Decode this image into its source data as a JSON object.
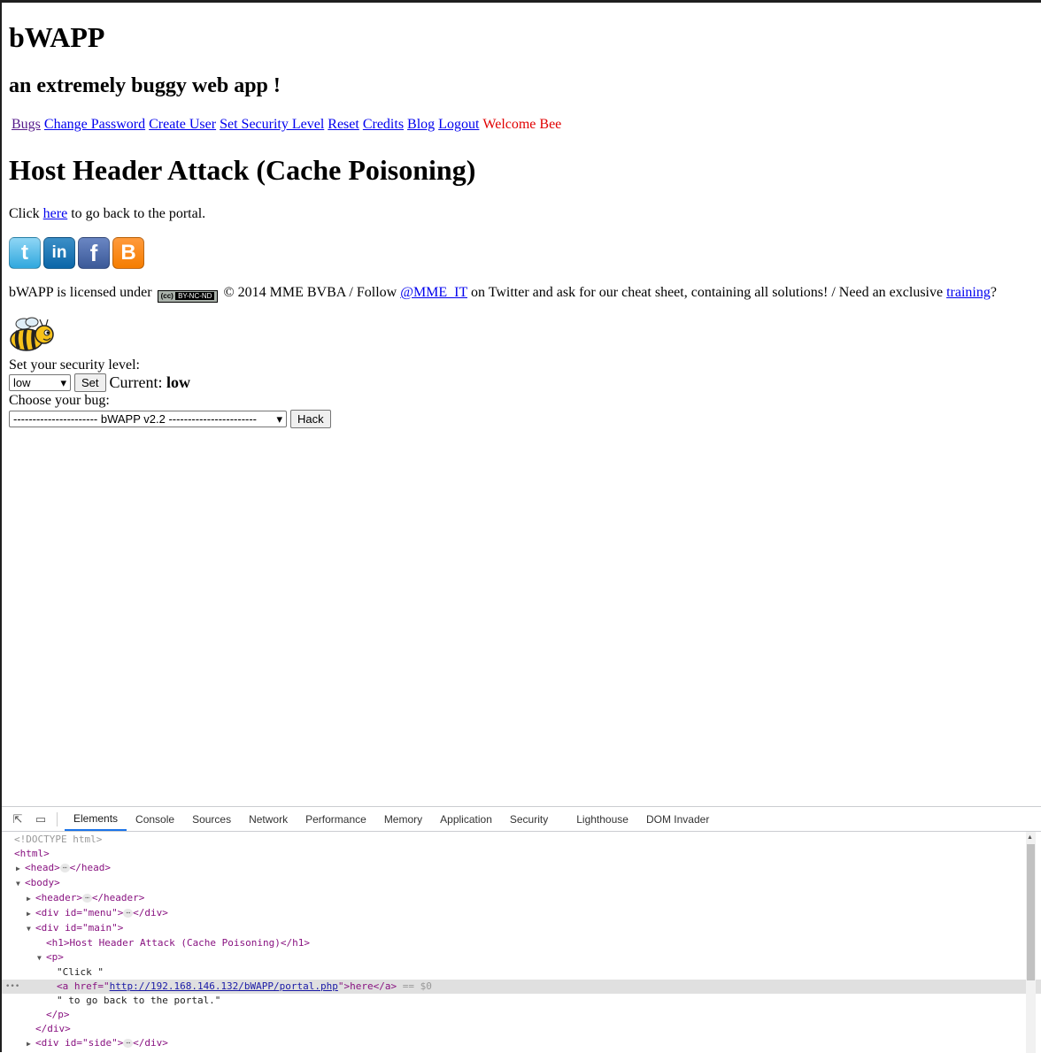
{
  "site": {
    "title": "bWAPP",
    "subtitle": "an extremely buggy web app !"
  },
  "menu": {
    "items": [
      "Bugs",
      "Change Password",
      "Create User",
      "Set Security Level",
      "Reset",
      "Credits",
      "Blog",
      "Logout"
    ],
    "welcome": "Welcome Bee"
  },
  "main": {
    "heading": "Host Header Attack (Cache Poisoning)",
    "back_prefix": "Click ",
    "back_link": "here",
    "back_suffix": " to go back to the portal."
  },
  "social": {
    "icons": [
      "twitter-icon",
      "linkedin-icon",
      "facebook-icon",
      "blogger-icon"
    ],
    "glyphs": [
      "t",
      "in",
      "f",
      "B"
    ]
  },
  "license": {
    "prefix": "bWAPP is licensed under ",
    "badge_cc": "(cc)",
    "badge_text": "BY-NC-ND",
    "middle": " © 2014 MME BVBA / Follow ",
    "twitter_link": "@MME_IT",
    "after_twitter": " on Twitter and ask for our cheat sheet, containing all solutions! / Need an exclusive ",
    "training_link": "training",
    "end": "?"
  },
  "security": {
    "label": "Set your security level:",
    "selected": "low",
    "set_button": "Set",
    "current_label": "Current: ",
    "current_value": "low"
  },
  "bug": {
    "label": "Choose your bug:",
    "selected": "---------------------- bWAPP v2.2 -----------------------",
    "hack_button": "Hack"
  },
  "devtools": {
    "tabs": [
      "Elements",
      "Console",
      "Sources",
      "Network",
      "Performance",
      "Memory",
      "Application",
      "Security",
      "Lighthouse",
      "DOM Invader"
    ],
    "active_tab": "Elements",
    "code": {
      "doctype": "<!DOCTYPE html>",
      "html_open": "<html>",
      "head": "<head>",
      "head_close": "</head>",
      "body_open": "<body>",
      "header": "<header>",
      "header_close": "</header>",
      "menu_div": "<div id=\"menu\">",
      "div_close": "</div>",
      "main_div": "<div id=\"main\">",
      "h1_line": "<h1>Host Header Attack (Cache Poisoning)</h1>",
      "p_open": "<p>",
      "text_click": "\"Click \"",
      "a_open_prefix": "<a href=\"",
      "a_href": "http://192.168.146.132/bWAPP/portal.php",
      "a_open_suffix": "\">here</a>",
      "selected_marker": " == $0",
      "text_back": "\" to go back to the portal.\"",
      "p_close": "</p>",
      "side_div": "<div id=\"side\">"
    }
  }
}
